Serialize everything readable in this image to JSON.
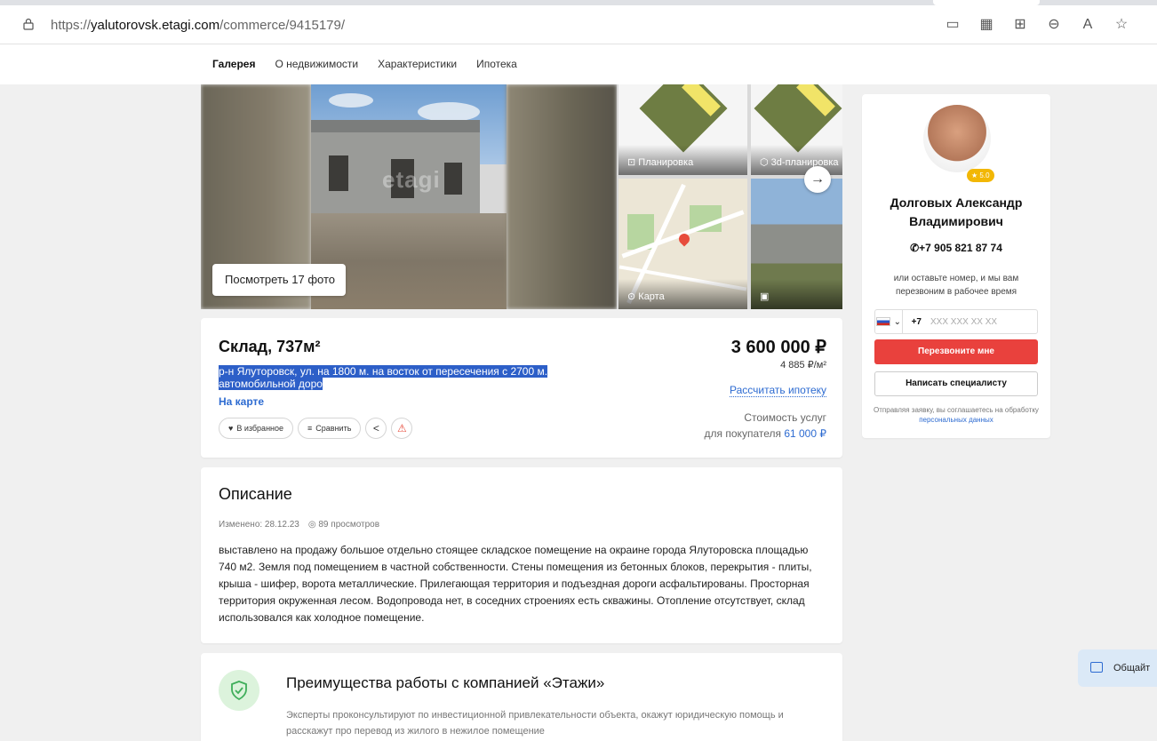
{
  "browser": {
    "url_prefix": "https://",
    "url_domain": "yalutorovsk.etagi.com",
    "url_path": "/commerce/9415179/"
  },
  "nav": {
    "items": [
      "Галерея",
      "О недвижимости",
      "Характеристики",
      "Ипотека"
    ],
    "active": "Галерея"
  },
  "gallery": {
    "watermark": "etagi",
    "photos_button": "Посмотреть 17 фото",
    "thumbs": [
      "Планировка",
      "3d-планировка",
      "Карта"
    ]
  },
  "listing": {
    "title": "Склад, 737м²",
    "address": "р-н Ялуторовск, ул. на 1800 м. на восток от пересечения с 2700 м. автомобильной доро",
    "map_link": "На карте",
    "favorite": "В избранное",
    "compare": "Сравнить",
    "price": "3 600 000 ₽",
    "price_per_m2": "4 885 ₽/м²",
    "mortgage_link": "Рассчитать ипотеку",
    "services_label_1": "Стоимость услуг",
    "services_label_2": "для покупателя",
    "services_price": "61 000 ₽"
  },
  "description": {
    "heading": "Описание",
    "changed": "Изменено: 28.12.23",
    "views": "89 просмотров",
    "text": "выставлено на продажу большое отдельно стоящее складское помещение на окраине города Ялуторовска площадью 740 м2. Земля под помещением в частной собственности. Стены помещения из бетонных блоков, перекрытия - плиты, крыша - шифер, ворота металлические. Прилегающая территория и подъездная дороги асфальтированы. Просторная территория окруженная лесом. Водопровода нет, в соседних строениях есть скважины. Отопление отсутствует, склад использовался как холодное помещение."
  },
  "advantages": {
    "heading": "Преимущества работы с компанией «Этажи»",
    "text": "Эксперты проконсультируют по инвестиционной привлекательности объекта, окажут юридическую помощь и расскажут про перевод из жилого в нежилое помещение"
  },
  "agent": {
    "rating": "5.0",
    "name_line_1": "Долговых Александр",
    "name_line_2": "Владимирович",
    "phone": "+7 905 821 87 74",
    "callback_hint": "или оставьте номер, и мы вам перезвоним в рабочее время",
    "phone_prefix": "+7",
    "phone_placeholder": "XXX XXX XX XX",
    "callback_button": "Перезвоните мне",
    "write_button": "Написать специалисту",
    "consent_text": "Отправляя заявку, вы соглашаетесь на обработку",
    "consent_link": "персональных данных"
  },
  "chat": {
    "label": "Общайт"
  },
  "colors": {
    "accent_blue": "#2d6bd1",
    "cta_red": "#e9413d",
    "rating_yellow": "#f2b705",
    "selection_blue": "#2d5fc8"
  }
}
